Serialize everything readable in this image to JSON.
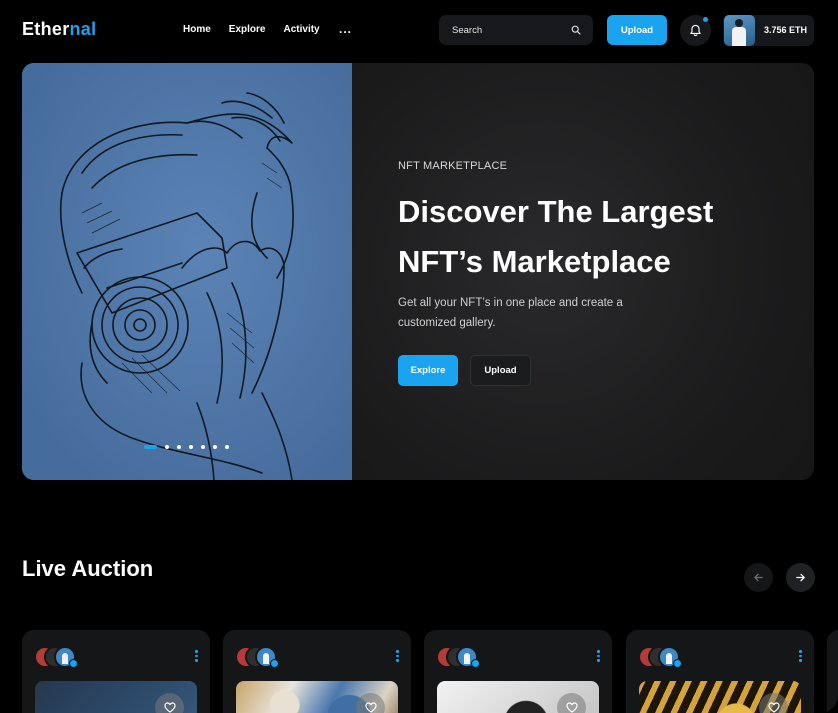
{
  "app": {
    "logo_part1": "Ether",
    "logo_part2": "nal",
    "accent_color": "#1aa3ef"
  },
  "nav": {
    "links": [
      "Home",
      "Explore",
      "Activity"
    ],
    "more_label": "...",
    "more_icon": "more-horizontal-icon"
  },
  "search": {
    "placeholder": "Search",
    "icon": "search-icon"
  },
  "header": {
    "upload_label": "Upload",
    "notification_icon": "bell-icon",
    "balance": "3.756 ETH"
  },
  "hero": {
    "eyebrow": "NFT MARKETPLACE",
    "title_line1": "Discover The Largest",
    "title_line2": "NFT’s Marketplace",
    "description": "Get all your NFT’s in one place and create a customized gallery.",
    "explore_label": "Explore",
    "upload_label": "Upload",
    "slide_count": 7,
    "active_slide": 1,
    "art": "sketch-photographer-with-camera"
  },
  "live_auction": {
    "title": "Live Auction",
    "prev_icon": "arrow-left-icon",
    "next_icon": "arrow-right-icon",
    "cards": [
      {
        "menu_icon": "kebab-icon",
        "like_icon": "heart-icon"
      },
      {
        "menu_icon": "kebab-icon",
        "like_icon": "heart-icon"
      },
      {
        "menu_icon": "kebab-icon",
        "like_icon": "heart-icon"
      },
      {
        "menu_icon": "kebab-icon",
        "like_icon": "heart-icon"
      }
    ]
  }
}
